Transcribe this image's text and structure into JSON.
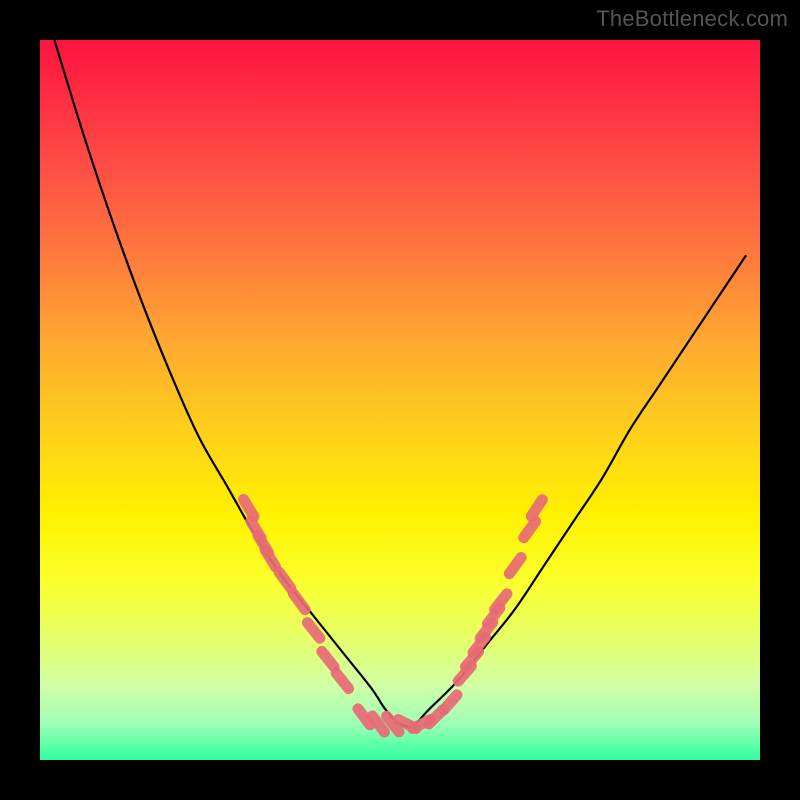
{
  "watermark": "TheBottleneck.com",
  "chart_data": {
    "type": "line",
    "title": "",
    "xlabel": "",
    "ylabel": "",
    "xlim": [
      0,
      100
    ],
    "ylim": [
      0,
      100
    ],
    "grid": false,
    "legend": false,
    "background": "red-yellow-green vertical gradient",
    "series": [
      {
        "name": "bottleneck-curve",
        "color": "#000000",
        "x": [
          2,
          6,
          10,
          14,
          18,
          22,
          26,
          30,
          34,
          38,
          42,
          46,
          48,
          50,
          52,
          54,
          58,
          62,
          66,
          70,
          74,
          78,
          82,
          86,
          90,
          94,
          98
        ],
        "y": [
          100,
          87,
          75,
          64,
          54,
          45,
          38,
          31,
          25,
          20,
          15,
          10,
          7,
          5,
          5,
          7,
          11,
          16,
          21,
          27,
          33,
          39,
          46,
          52,
          58,
          64,
          70
        ]
      }
    ],
    "markers": [
      {
        "name": "left-cluster",
        "color": "#e86b75",
        "points": [
          {
            "x": 29,
            "y": 35
          },
          {
            "x": 30,
            "y": 32
          },
          {
            "x": 31,
            "y": 30
          },
          {
            "x": 32,
            "y": 28
          },
          {
            "x": 34,
            "y": 25
          },
          {
            "x": 36,
            "y": 22
          },
          {
            "x": 38,
            "y": 18
          },
          {
            "x": 40,
            "y": 14
          },
          {
            "x": 42,
            "y": 11
          }
        ]
      },
      {
        "name": "bottom-cluster",
        "color": "#e86b75",
        "points": [
          {
            "x": 45,
            "y": 6
          },
          {
            "x": 47,
            "y": 5
          },
          {
            "x": 49,
            "y": 5
          },
          {
            "x": 51,
            "y": 5
          },
          {
            "x": 53,
            "y": 5
          },
          {
            "x": 55,
            "y": 6
          },
          {
            "x": 57,
            "y": 8
          }
        ]
      },
      {
        "name": "right-cluster",
        "color": "#e86b75",
        "points": [
          {
            "x": 59,
            "y": 12
          },
          {
            "x": 60,
            "y": 14
          },
          {
            "x": 61,
            "y": 16
          },
          {
            "x": 62,
            "y": 18
          },
          {
            "x": 63,
            "y": 20
          },
          {
            "x": 64,
            "y": 22
          },
          {
            "x": 66,
            "y": 27
          },
          {
            "x": 68,
            "y": 32
          },
          {
            "x": 69,
            "y": 35
          }
        ]
      }
    ]
  }
}
